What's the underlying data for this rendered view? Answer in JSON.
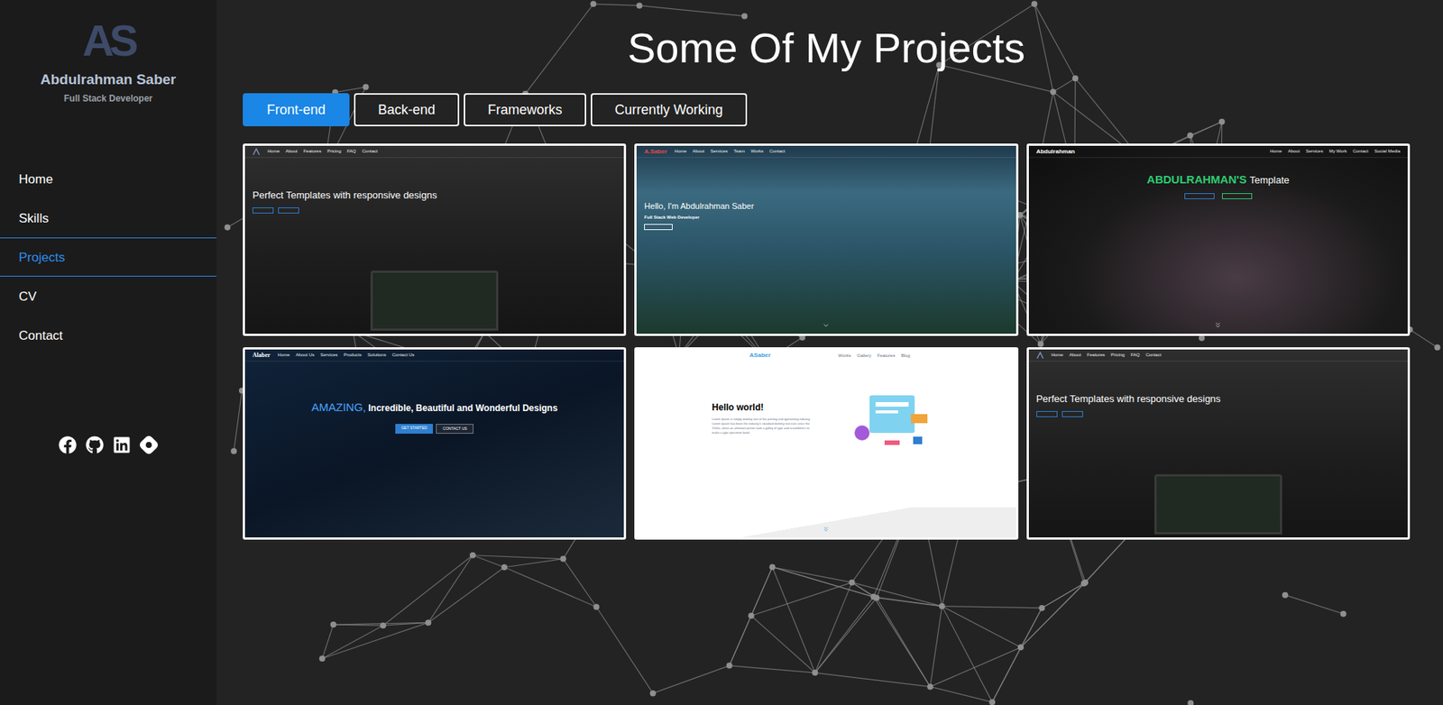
{
  "sidebar": {
    "logo": "AS",
    "name": "Abdulrahman Saber",
    "role": "Full Stack Developer",
    "items": [
      {
        "label": "Home",
        "selected": false
      },
      {
        "label": "Skills",
        "selected": false
      },
      {
        "label": "Projects",
        "selected": true
      },
      {
        "label": "CV",
        "selected": false
      },
      {
        "label": "Contact",
        "selected": false
      }
    ]
  },
  "page": {
    "title": "Some Of My Projects"
  },
  "tabs": [
    {
      "label": "Front-end",
      "selected": true
    },
    {
      "label": "Back-end",
      "selected": false
    },
    {
      "label": "Frameworks",
      "selected": false
    },
    {
      "label": "Currently Working",
      "selected": false
    }
  ],
  "projects": [
    {
      "kind": "templates",
      "nav": [
        "Home",
        "About",
        "Features",
        "Pricing",
        "FAQ",
        "Contact"
      ],
      "headline": "Perfect Templates with responsive designs"
    },
    {
      "kind": "portfolio",
      "brand": "A.Saber",
      "nav": [
        "Home",
        "About",
        "Services",
        "Team",
        "Works",
        "Contact"
      ],
      "headline": "Hello, I'm Abdulrahman Saber",
      "subtitle": "Full Stack Web Developer"
    },
    {
      "kind": "keyboard",
      "brand": "Abdulrahman",
      "nav": [
        "Home",
        "About",
        "Services",
        "My Work",
        "Contact",
        "Social Media"
      ],
      "accent": "ABDULRAHMAN'S",
      "headline": "Template"
    },
    {
      "kind": "code",
      "brand": "Alaber",
      "nav": [
        "Home",
        "About Us",
        "Services",
        "Products",
        "Solutions",
        "Contact Us"
      ],
      "accent": "AMAZING,",
      "headline": "Incredible, Beautiful and Wonderful Designs",
      "buttons": [
        "GET STARTED",
        "CONTACT US"
      ]
    },
    {
      "kind": "light",
      "brand": "ASaber",
      "nav": [
        "Works",
        "Gallery",
        "Features",
        "Blog"
      ],
      "headline": "Hello world!",
      "body": "Lorem Ipsum is simply dummy text of the printing and typesetting industry. Lorem Ipsum has been the industry's standard dummy text ever since the 1500s, when an unknown printer took a galley of type and scrambled it to make a type specimen book."
    },
    {
      "kind": "templates",
      "nav": [
        "Home",
        "About",
        "Features",
        "Pricing",
        "FAQ",
        "Contact"
      ],
      "headline": "Perfect Templates with responsive designs"
    }
  ]
}
